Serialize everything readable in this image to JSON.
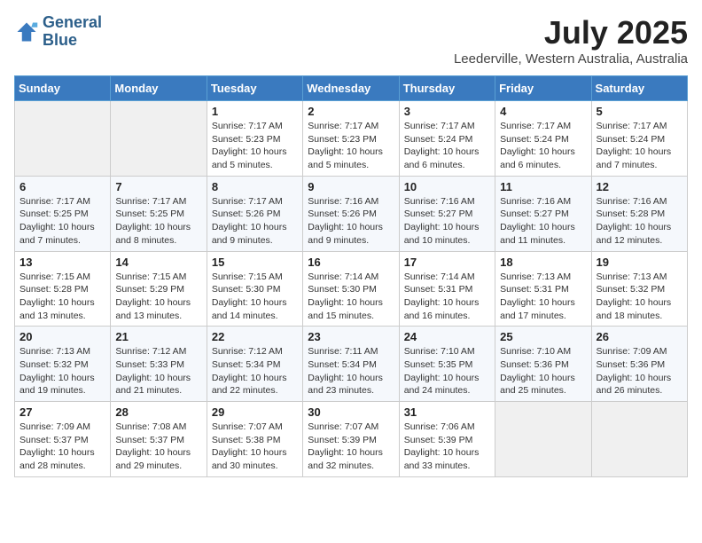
{
  "header": {
    "logo_line1": "General",
    "logo_line2": "Blue",
    "month": "July 2025",
    "location": "Leederville, Western Australia, Australia"
  },
  "days_of_week": [
    "Sunday",
    "Monday",
    "Tuesday",
    "Wednesday",
    "Thursday",
    "Friday",
    "Saturday"
  ],
  "weeks": [
    [
      {
        "day": "",
        "detail": ""
      },
      {
        "day": "",
        "detail": ""
      },
      {
        "day": "1",
        "detail": "Sunrise: 7:17 AM\nSunset: 5:23 PM\nDaylight: 10 hours and 5 minutes."
      },
      {
        "day": "2",
        "detail": "Sunrise: 7:17 AM\nSunset: 5:23 PM\nDaylight: 10 hours and 5 minutes."
      },
      {
        "day": "3",
        "detail": "Sunrise: 7:17 AM\nSunset: 5:24 PM\nDaylight: 10 hours and 6 minutes."
      },
      {
        "day": "4",
        "detail": "Sunrise: 7:17 AM\nSunset: 5:24 PM\nDaylight: 10 hours and 6 minutes."
      },
      {
        "day": "5",
        "detail": "Sunrise: 7:17 AM\nSunset: 5:24 PM\nDaylight: 10 hours and 7 minutes."
      }
    ],
    [
      {
        "day": "6",
        "detail": "Sunrise: 7:17 AM\nSunset: 5:25 PM\nDaylight: 10 hours and 7 minutes."
      },
      {
        "day": "7",
        "detail": "Sunrise: 7:17 AM\nSunset: 5:25 PM\nDaylight: 10 hours and 8 minutes."
      },
      {
        "day": "8",
        "detail": "Sunrise: 7:17 AM\nSunset: 5:26 PM\nDaylight: 10 hours and 9 minutes."
      },
      {
        "day": "9",
        "detail": "Sunrise: 7:16 AM\nSunset: 5:26 PM\nDaylight: 10 hours and 9 minutes."
      },
      {
        "day": "10",
        "detail": "Sunrise: 7:16 AM\nSunset: 5:27 PM\nDaylight: 10 hours and 10 minutes."
      },
      {
        "day": "11",
        "detail": "Sunrise: 7:16 AM\nSunset: 5:27 PM\nDaylight: 10 hours and 11 minutes."
      },
      {
        "day": "12",
        "detail": "Sunrise: 7:16 AM\nSunset: 5:28 PM\nDaylight: 10 hours and 12 minutes."
      }
    ],
    [
      {
        "day": "13",
        "detail": "Sunrise: 7:15 AM\nSunset: 5:28 PM\nDaylight: 10 hours and 13 minutes."
      },
      {
        "day": "14",
        "detail": "Sunrise: 7:15 AM\nSunset: 5:29 PM\nDaylight: 10 hours and 13 minutes."
      },
      {
        "day": "15",
        "detail": "Sunrise: 7:15 AM\nSunset: 5:30 PM\nDaylight: 10 hours and 14 minutes."
      },
      {
        "day": "16",
        "detail": "Sunrise: 7:14 AM\nSunset: 5:30 PM\nDaylight: 10 hours and 15 minutes."
      },
      {
        "day": "17",
        "detail": "Sunrise: 7:14 AM\nSunset: 5:31 PM\nDaylight: 10 hours and 16 minutes."
      },
      {
        "day": "18",
        "detail": "Sunrise: 7:13 AM\nSunset: 5:31 PM\nDaylight: 10 hours and 17 minutes."
      },
      {
        "day": "19",
        "detail": "Sunrise: 7:13 AM\nSunset: 5:32 PM\nDaylight: 10 hours and 18 minutes."
      }
    ],
    [
      {
        "day": "20",
        "detail": "Sunrise: 7:13 AM\nSunset: 5:32 PM\nDaylight: 10 hours and 19 minutes."
      },
      {
        "day": "21",
        "detail": "Sunrise: 7:12 AM\nSunset: 5:33 PM\nDaylight: 10 hours and 21 minutes."
      },
      {
        "day": "22",
        "detail": "Sunrise: 7:12 AM\nSunset: 5:34 PM\nDaylight: 10 hours and 22 minutes."
      },
      {
        "day": "23",
        "detail": "Sunrise: 7:11 AM\nSunset: 5:34 PM\nDaylight: 10 hours and 23 minutes."
      },
      {
        "day": "24",
        "detail": "Sunrise: 7:10 AM\nSunset: 5:35 PM\nDaylight: 10 hours and 24 minutes."
      },
      {
        "day": "25",
        "detail": "Sunrise: 7:10 AM\nSunset: 5:36 PM\nDaylight: 10 hours and 25 minutes."
      },
      {
        "day": "26",
        "detail": "Sunrise: 7:09 AM\nSunset: 5:36 PM\nDaylight: 10 hours and 26 minutes."
      }
    ],
    [
      {
        "day": "27",
        "detail": "Sunrise: 7:09 AM\nSunset: 5:37 PM\nDaylight: 10 hours and 28 minutes."
      },
      {
        "day": "28",
        "detail": "Sunrise: 7:08 AM\nSunset: 5:37 PM\nDaylight: 10 hours and 29 minutes."
      },
      {
        "day": "29",
        "detail": "Sunrise: 7:07 AM\nSunset: 5:38 PM\nDaylight: 10 hours and 30 minutes."
      },
      {
        "day": "30",
        "detail": "Sunrise: 7:07 AM\nSunset: 5:39 PM\nDaylight: 10 hours and 32 minutes."
      },
      {
        "day": "31",
        "detail": "Sunrise: 7:06 AM\nSunset: 5:39 PM\nDaylight: 10 hours and 33 minutes."
      },
      {
        "day": "",
        "detail": ""
      },
      {
        "day": "",
        "detail": ""
      }
    ]
  ]
}
